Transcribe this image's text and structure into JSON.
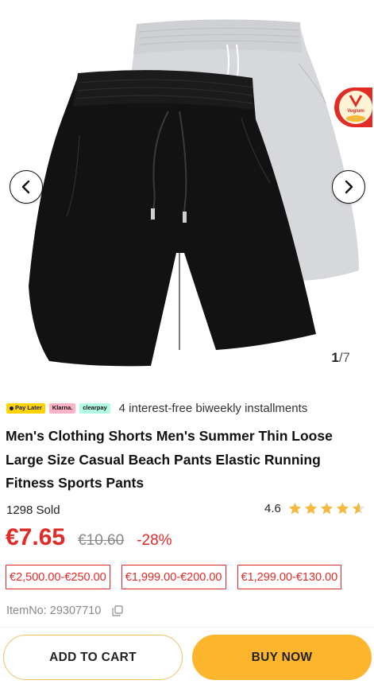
{
  "gallery": {
    "current": "1",
    "total": "/7",
    "prev_icon": "chevron-left-icon",
    "next_icon": "chevron-right-icon",
    "badge_text": "Vogium",
    "colors": {
      "grey_shorts": "#d7d8dc",
      "black_shorts": "#111111"
    }
  },
  "payment": {
    "chips": [
      "Pay Later",
      "Klarna.",
      "clearpay"
    ],
    "text": "4 interest-free biweekly installments"
  },
  "product": {
    "title": "Men's Clothing Shorts Men's Summer Thin Loose Large Size Casual Beach Pants Elastic Running Fitness Sports Pants",
    "sold": "1298 Sold",
    "rating": "4.6",
    "rating_value": 4.6,
    "rating_max": 5,
    "price": "€7.65",
    "old_price": "€10.60",
    "discount": "-28%",
    "item_no": "ItemNo: 29307710"
  },
  "coupons": [
    "€2,500.00-€250.00",
    "€1,999.00-€200.00",
    "€1,299.00-€130.00"
  ],
  "actions": {
    "add_to_cart": "ADD TO CART",
    "buy_now": "BUY NOW"
  },
  "colors": {
    "price_red": "#e02b27",
    "star": "#f5b93b",
    "buy_button": "#fdb52d",
    "cart_border": "#f2c06a"
  }
}
